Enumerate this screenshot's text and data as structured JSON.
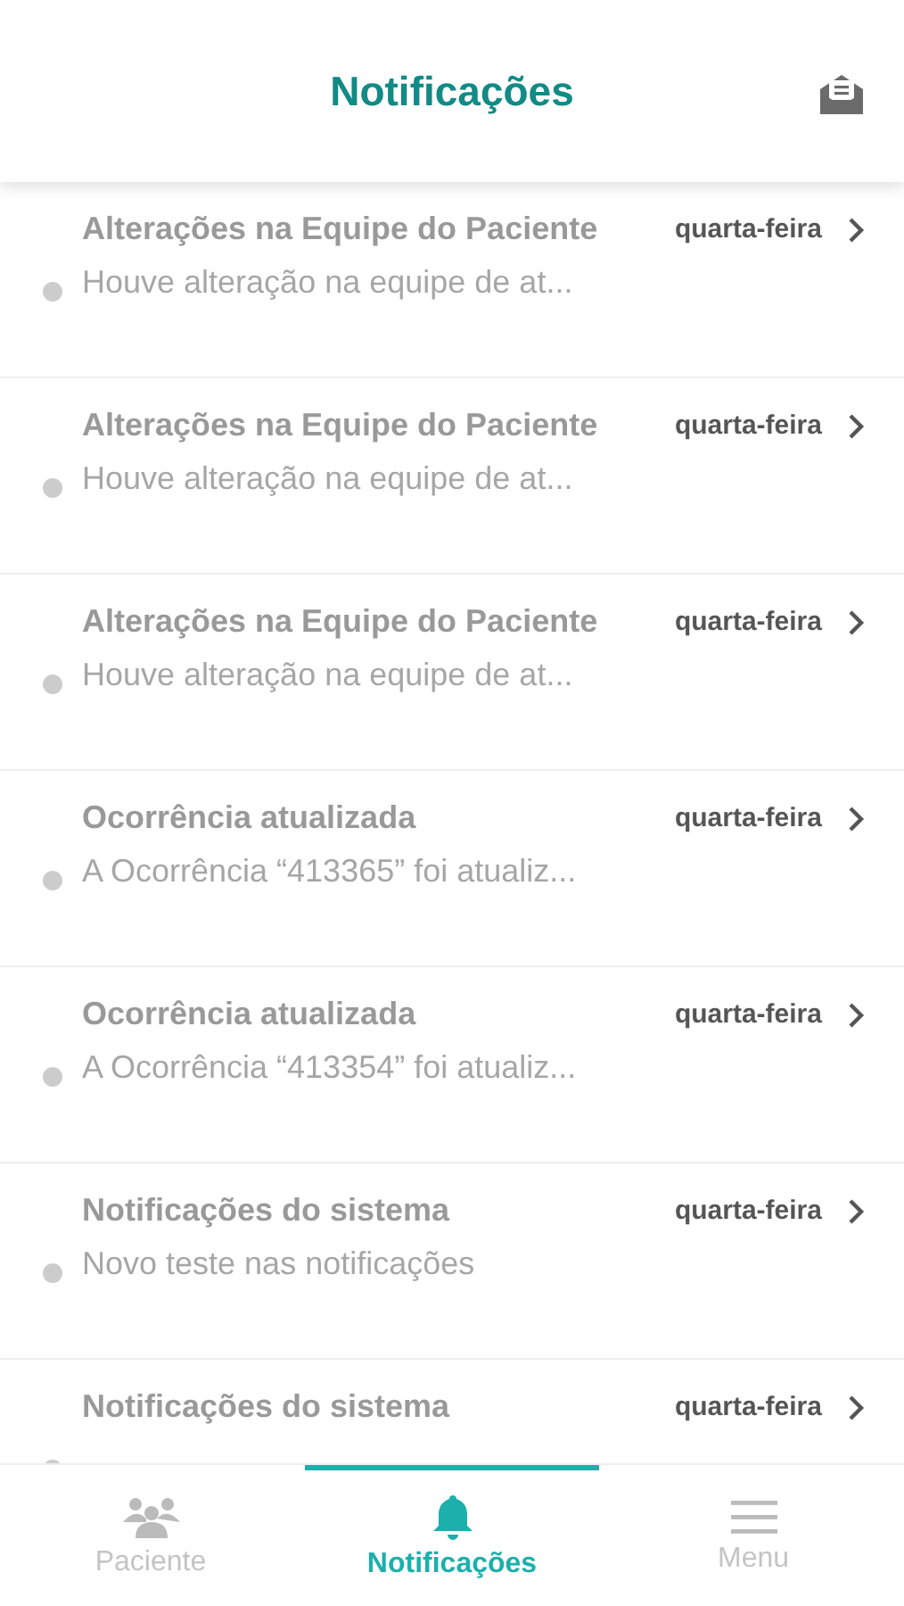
{
  "header": {
    "title": "Notificações"
  },
  "notifications": [
    {
      "title": "Alterações na Equipe do Paciente",
      "message": "Houve alteração na equipe de at...",
      "date": "quarta-feira"
    },
    {
      "title": "Alterações na Equipe do Paciente",
      "message": "Houve alteração na equipe de at...",
      "date": "quarta-feira"
    },
    {
      "title": "Alterações na Equipe do Paciente",
      "message": "Houve alteração na equipe de at...",
      "date": "quarta-feira"
    },
    {
      "title": "Ocorrência atualizada",
      "message": "A Ocorrência “413365” foi atualiz...",
      "date": "quarta-feira"
    },
    {
      "title": "Ocorrência atualizada",
      "message": "A Ocorrência “413354” foi atualiz...",
      "date": "quarta-feira"
    },
    {
      "title": "Notificações do sistema",
      "message": "Novo teste nas notificações",
      "date": "quarta-feira"
    },
    {
      "title": "Notificações do sistema",
      "date": "quarta-feira"
    }
  ],
  "tabs": [
    {
      "kind": "people",
      "label": "Paciente",
      "selected": false
    },
    {
      "kind": "bell",
      "label": "Notificações",
      "selected": true
    },
    {
      "kind": "menu",
      "label": "Menu",
      "selected": false
    }
  ]
}
